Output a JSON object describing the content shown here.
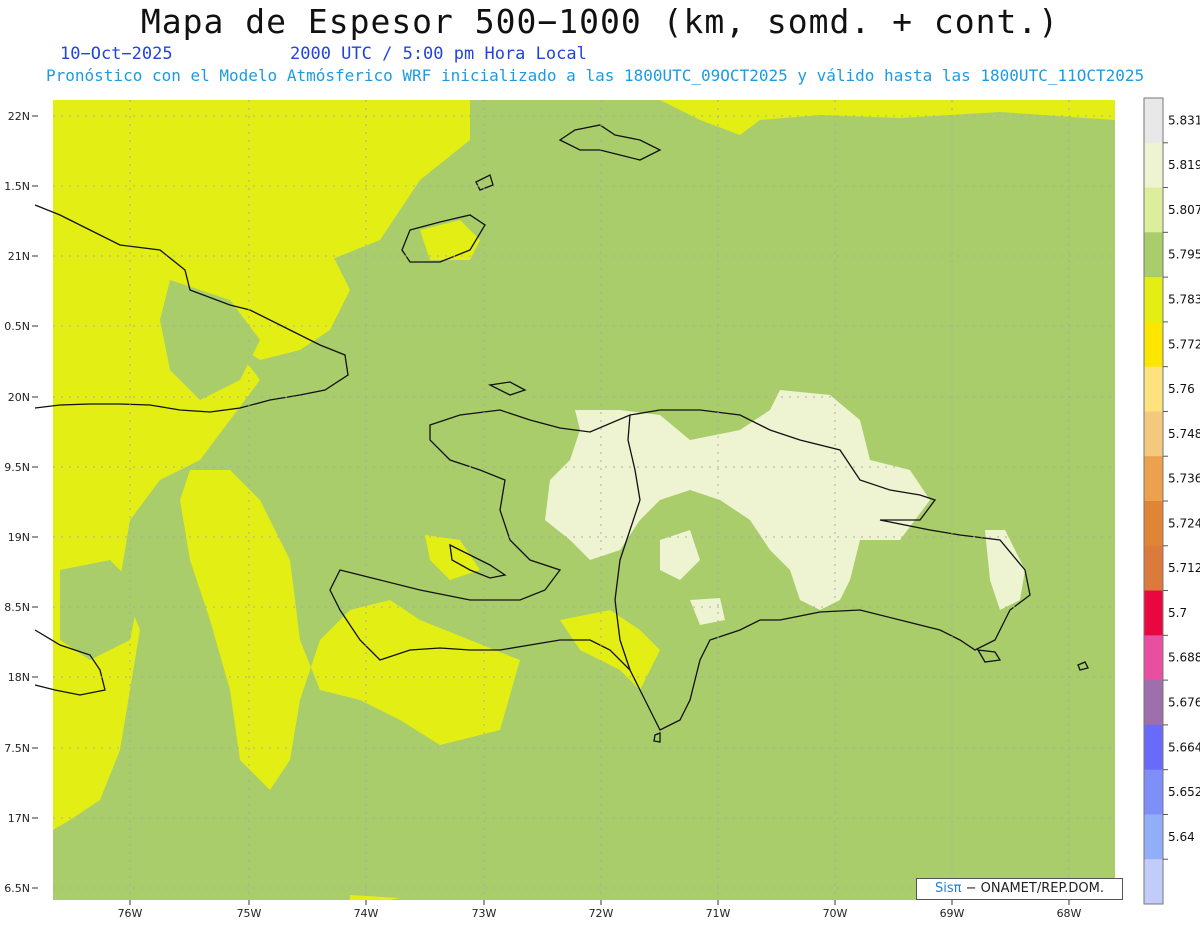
{
  "header": {
    "title": "Mapa de Espesor 500−1000 (km, somd. + cont.)",
    "date": "10−Oct−2025",
    "time": "2000 UTC / 5:00 pm Hora Local",
    "subtitle": "Pronóstico con el Modelo Atmósferico WRF inicializado a las 1800UTC_09OCT2025 y válido hasta las  1800UTC_11OCT2025"
  },
  "axes": {
    "lat_labels": [
      "22N",
      "1.5N",
      "21N",
      "0.5N",
      "20N",
      "9.5N",
      "19N",
      "8.5N",
      "18N",
      "7.5N",
      "17N",
      "6.5N"
    ],
    "lon_labels": [
      "76W",
      "75W",
      "74W",
      "73W",
      "72W",
      "71W",
      "70W",
      "69W",
      "68W"
    ]
  },
  "colorbar": {
    "labels": [
      "5.831",
      "5.819",
      "5.807",
      "5.795",
      "5.783",
      "5.772",
      "5.76",
      "5.748",
      "5.736",
      "5.724",
      "5.712",
      "5.7",
      "5.688",
      "5.676",
      "5.664",
      "5.652",
      "5.64"
    ],
    "colors": [
      "#e8e8e8",
      "#eef3d2",
      "#dcee9c",
      "#a9cd6a",
      "#e2ee14",
      "#fbe600",
      "#fde27e",
      "#f2c97d",
      "#eba14d",
      "#e18534",
      "#dc7a3c",
      "#e8073e",
      "#e94fa1",
      "#9e6fad",
      "#6a6afa",
      "#7e8ffa",
      "#93aef9",
      "#c2ccf9"
    ]
  },
  "map": {
    "colors": {
      "green": "#a9cd6a",
      "yellow": "#e2ee14",
      "pale": "#eef3d2",
      "grid": "#aaaaaa",
      "coast": "#111111"
    }
  },
  "credit": {
    "brand": "Sisπ",
    "org": "− ONAMET/REP.DOM."
  }
}
